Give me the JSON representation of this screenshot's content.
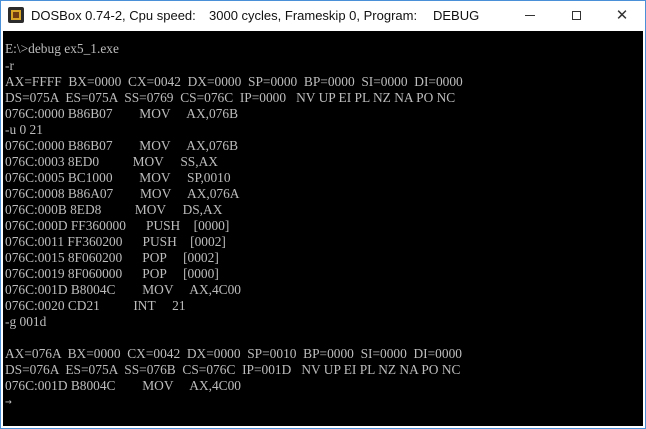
{
  "window": {
    "app_title": "DOSBox 0.74-2, Cpu speed:",
    "speed_info": "3000 cycles, Frameskip  0, Program:",
    "program_name": "DEBUG",
    "icons": {
      "app": "dosbox-app-icon",
      "minimize": "minimize-icon",
      "maximize": "maximize-icon",
      "close": "close-icon"
    },
    "close_glyph": "✕"
  },
  "console": {
    "lines": [
      "E:\\>debug ex5_1.exe",
      "-r",
      "AX=FFFF  BX=0000  CX=0042  DX=0000  SP=0000  BP=0000  SI=0000  DI=0000",
      "DS=075A  ES=075A  SS=0769  CS=076C  IP=0000   NV UP EI PL NZ NA PO NC",
      "076C:0000 B86B07        MOV     AX,076B",
      "-u 0 21",
      "076C:0000 B86B07        MOV     AX,076B",
      "076C:0003 8ED0          MOV     SS,AX",
      "076C:0005 BC1000        MOV     SP,0010",
      "076C:0008 B86A07        MOV     AX,076A",
      "076C:000B 8ED8          MOV     DS,AX",
      "076C:000D FF360000      PUSH    [0000]",
      "076C:0011 FF360200      PUSH    [0002]",
      "076C:0015 8F060200      POP     [0002]",
      "076C:0019 8F060000      POP     [0000]",
      "076C:001D B8004C        MOV     AX,4C00",
      "076C:0020 CD21          INT     21",
      "-g 001d",
      "",
      "AX=076A  BX=0000  CX=0042  DX=0000  SP=0010  BP=0000  SI=0000  DI=0000",
      "DS=076A  ES=075A  SS=076B  CS=076C  IP=001D   NV UP EI PL NZ NA PO NC",
      "076C:001D B8004C        MOV     AX,4C00"
    ],
    "prompt": "-",
    "cursor_glyph": "→"
  }
}
